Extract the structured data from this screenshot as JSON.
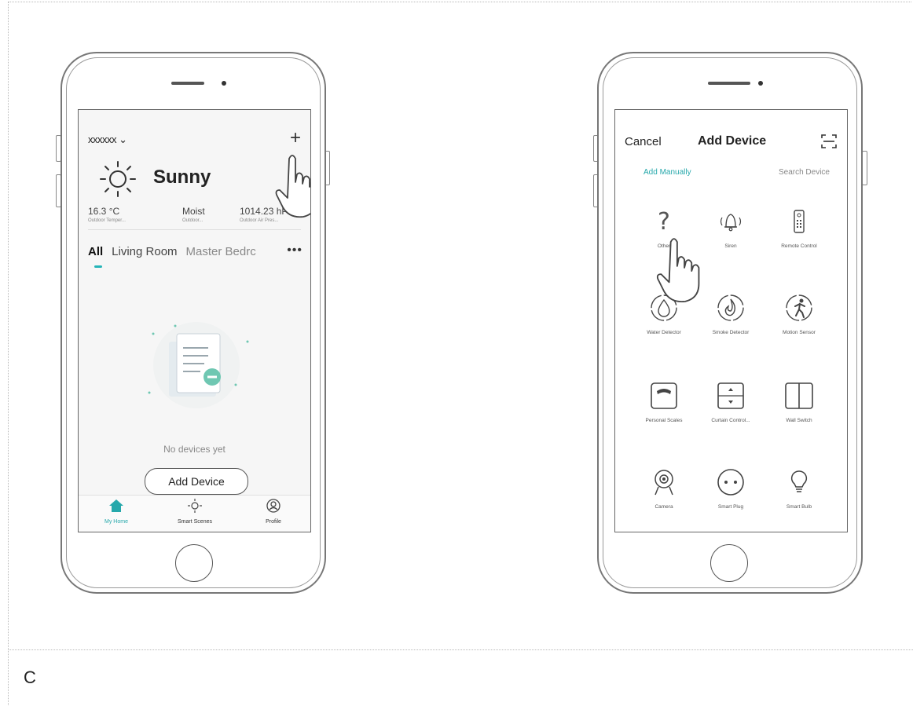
{
  "left_phone": {
    "home_name": "xxxxxx ⌄",
    "add_icon": "plus-icon",
    "weather": {
      "icon": "sun-icon",
      "label": "Sunny"
    },
    "stats": [
      {
        "value": "16.3 °C",
        "label": "Outdoor Temper..."
      },
      {
        "value": "Moist",
        "label": "Outdoor..."
      },
      {
        "value": "1014.23 hPa",
        "label": "Outdoor Air Pres..."
      }
    ],
    "rooms": [
      "All",
      "Living Room",
      "Master Bedrc"
    ],
    "more_icon": "more-dots-icon",
    "empty_text": "No devices yet",
    "add_device_button": "Add Device",
    "tabbar": [
      {
        "label": "My Home",
        "icon": "home-icon"
      },
      {
        "label": "Smart Scenes",
        "icon": "sun-icon"
      },
      {
        "label": "Profile",
        "icon": "profile-icon"
      }
    ]
  },
  "right_phone": {
    "cancel": "Cancel",
    "title": "Add Device",
    "scan_icon": "scan-icon",
    "tabs": [
      "Add Manually",
      "Search Device"
    ],
    "devices": [
      {
        "name": "Other",
        "icon": "question-icon"
      },
      {
        "name": "Siren",
        "icon": "bell-icon"
      },
      {
        "name": "Remote Control",
        "icon": "remote-icon"
      },
      {
        "name": "Water Detector",
        "icon": "water-drop-icon"
      },
      {
        "name": "Smoke Detector",
        "icon": "smoke-icon"
      },
      {
        "name": "Motion Sensor",
        "icon": "motion-icon"
      },
      {
        "name": "Personal Scales",
        "icon": "scale-icon"
      },
      {
        "name": "Curtain Control...",
        "icon": "curtain-icon"
      },
      {
        "name": "Wall Switch",
        "icon": "switch-icon"
      },
      {
        "name": "Camera",
        "icon": "camera-icon"
      },
      {
        "name": "Smart Plug",
        "icon": "plug-icon"
      },
      {
        "name": "Smart Bulb",
        "icon": "bulb-icon"
      }
    ]
  },
  "caption": "C",
  "colors": {
    "accent": "#26b5b8",
    "outline": "#555555"
  }
}
